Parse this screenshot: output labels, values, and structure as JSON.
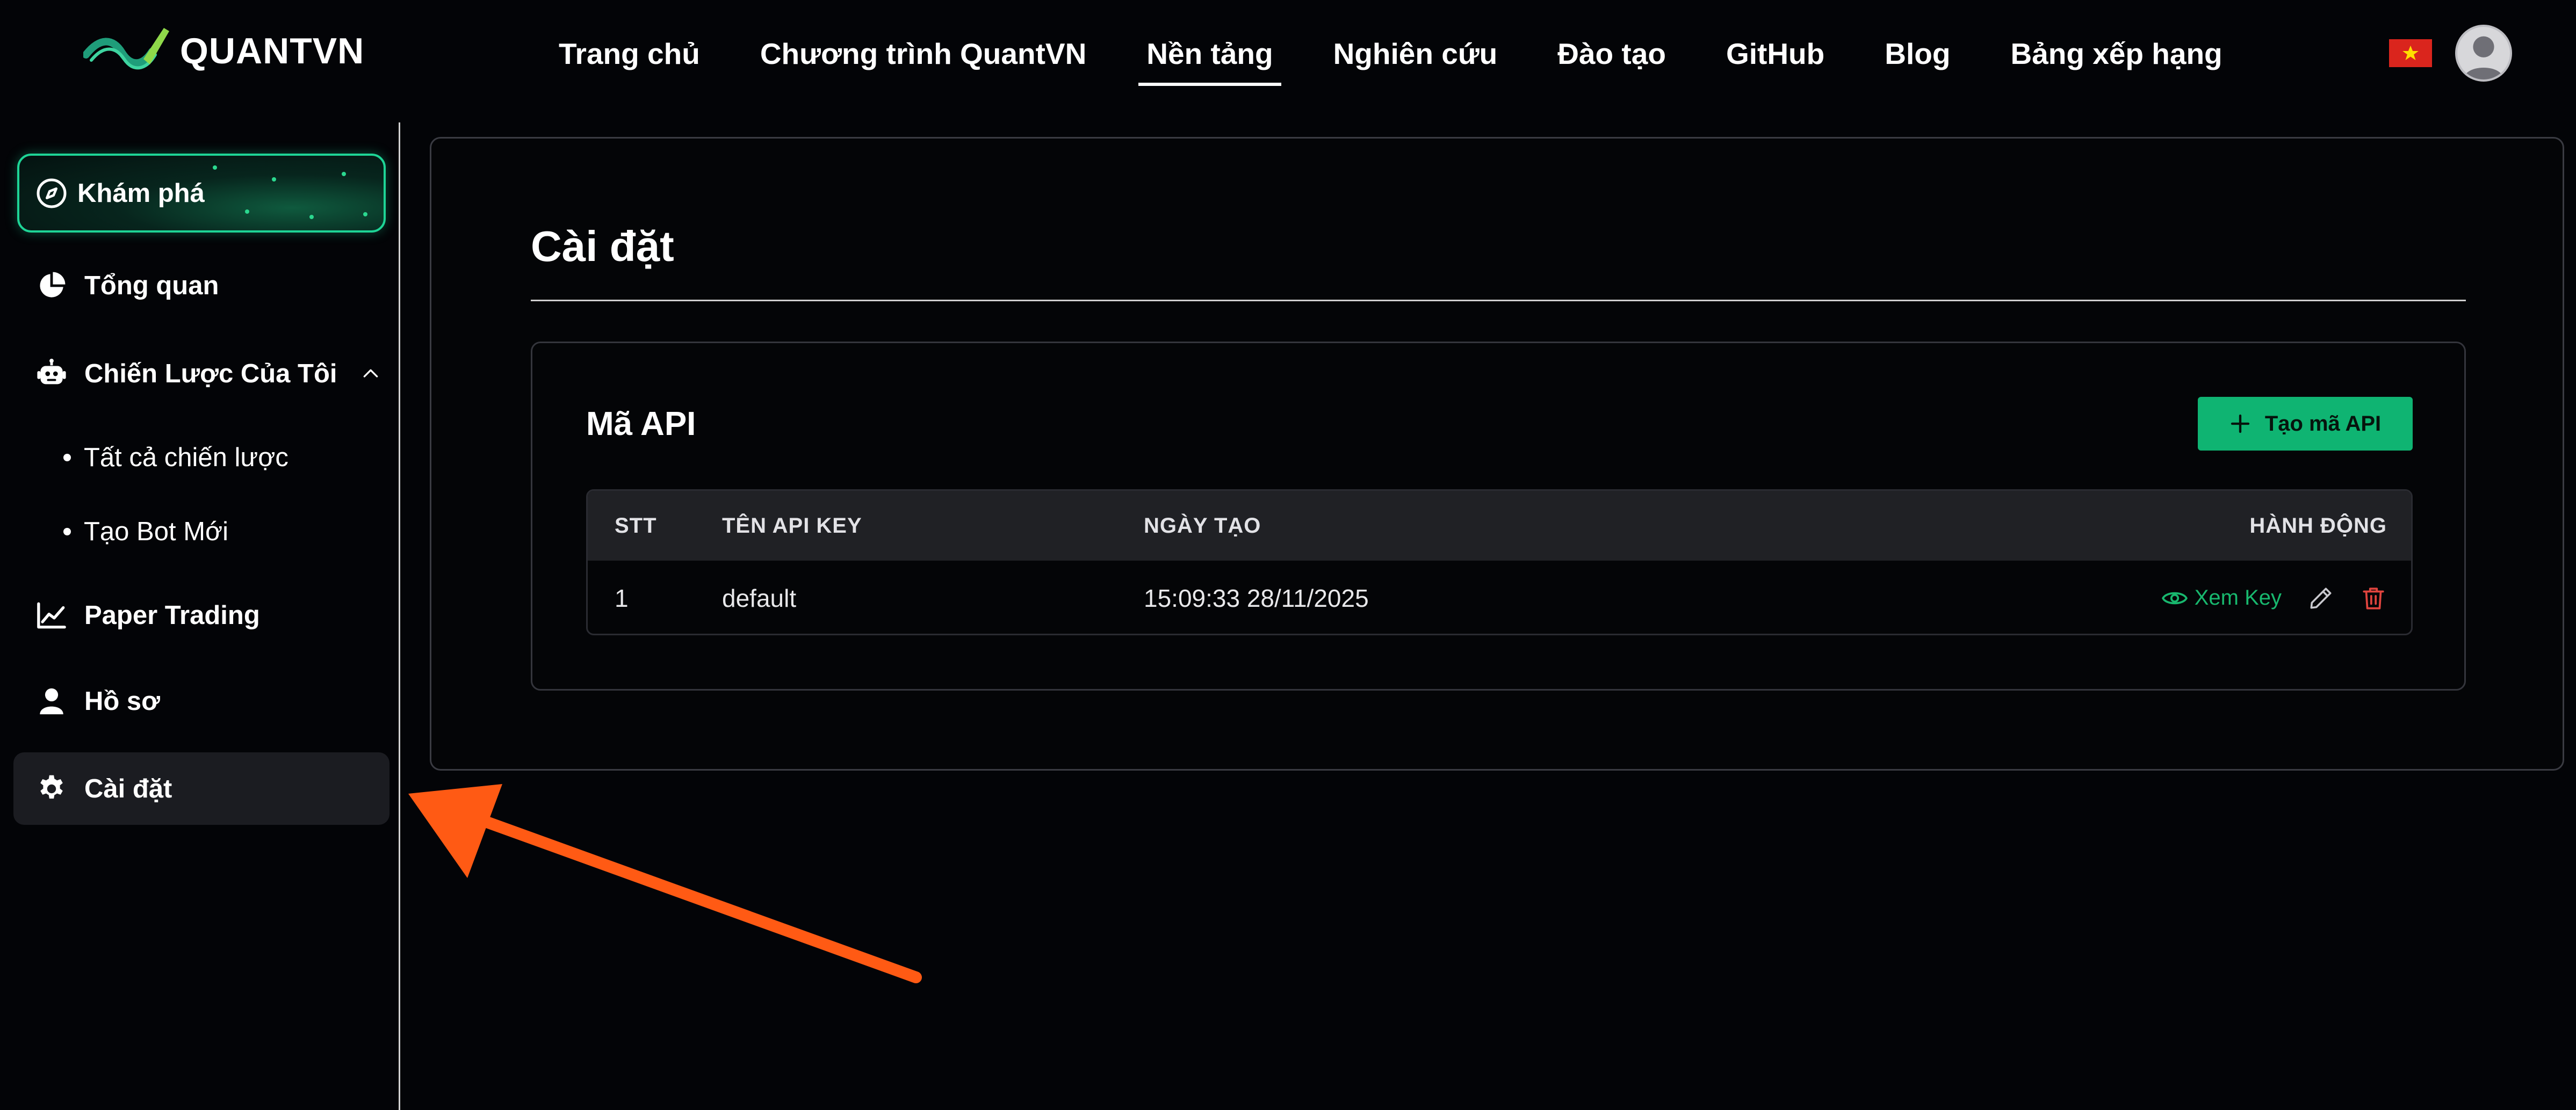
{
  "brand": {
    "name": "QUANTVN",
    "logo_icon": "quantvn-wave-logo"
  },
  "nav": {
    "items": [
      {
        "label": "Trang chủ",
        "active": false
      },
      {
        "label": "Chương trình QuantVN",
        "active": false
      },
      {
        "label": "Nền tảng",
        "active": true
      },
      {
        "label": "Nghiên cứu",
        "active": false
      },
      {
        "label": "Đào tạo",
        "active": false
      },
      {
        "label": "GitHub",
        "active": false
      },
      {
        "label": "Blog",
        "active": false
      },
      {
        "label": "Bảng xếp hạng",
        "active": false
      }
    ],
    "language_flag": "vietnam-flag-icon",
    "avatar_icon": "user-avatar-icon"
  },
  "sidebar": {
    "explore": {
      "label": "Khám phá",
      "icon": "compass-icon"
    },
    "overview": {
      "label": "Tổng quan",
      "icon": "pie-chart-icon"
    },
    "strategies": {
      "label": "Chiến Lược Của Tôi",
      "icon": "robot-icon",
      "expanded": true,
      "children": [
        {
          "label": "Tất cả chiến lược"
        },
        {
          "label": "Tạo Bot Mới"
        }
      ]
    },
    "paper_trading": {
      "label": "Paper Trading",
      "icon": "line-chart-icon"
    },
    "profile": {
      "label": "Hồ sơ",
      "icon": "user-icon"
    },
    "settings": {
      "label": "Cài đặt",
      "icon": "gear-icon",
      "selected": true
    }
  },
  "main": {
    "title": "Cài đặt",
    "api_card": {
      "title": "Mã API",
      "create_button": "Tạo mã API",
      "columns": [
        "STT",
        "TÊN API KEY",
        "NGÀY TẠO",
        "HÀNH ĐỘNG"
      ],
      "rows": [
        {
          "stt": "1",
          "name": "default",
          "created": "15:09:33 28/11/2025"
        }
      ],
      "view_key_label": "Xem Key"
    }
  },
  "colors": {
    "background": "#030407",
    "accent_green": "#0fb472",
    "explore_border": "#1ed496",
    "delete_red": "#e0443e",
    "arrow_orange": "#ff5a14"
  }
}
